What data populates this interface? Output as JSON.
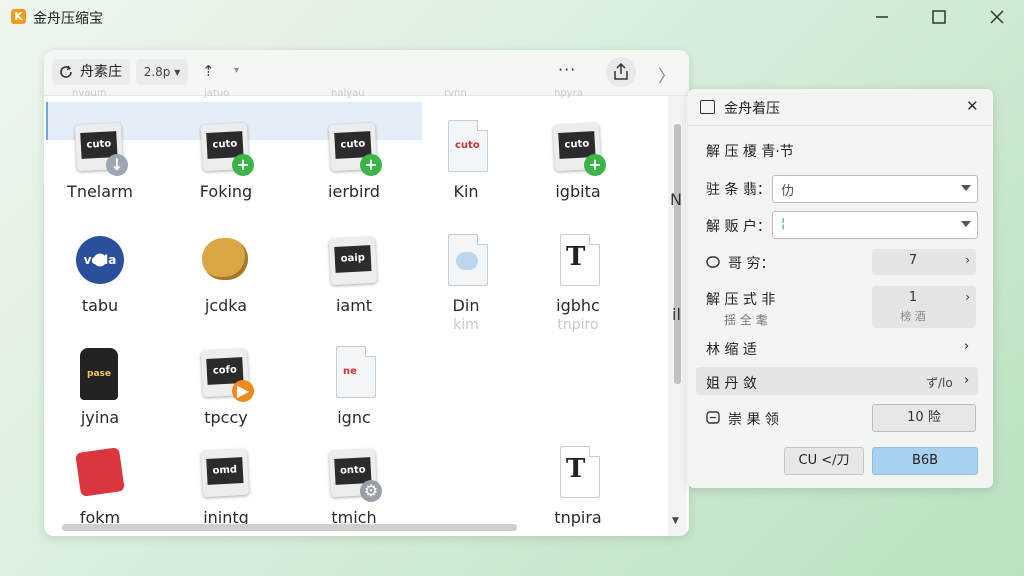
{
  "app": {
    "title": "金舟压缩宝",
    "logo_letter": "K"
  },
  "window_controls": {
    "minimize": "—",
    "maximize": "☐",
    "close": "✕"
  },
  "toolbar": {
    "path_label": "舟素庄",
    "size_label": "2.8p",
    "size_caret": "▾",
    "sort_symbol": "⇡",
    "sort_caret": "▾",
    "more": "···",
    "close_symbol": "〉"
  },
  "ghost_labels": [
    "nvaum",
    "jatuo",
    "nalyau",
    "rvnn",
    "npyra"
  ],
  "files": [
    {
      "name": "Tnelarm",
      "sub": "",
      "icon": "archive-icon",
      "tile_text": "cuto",
      "badge": "arrow",
      "badge_symbol": "↓"
    },
    {
      "name": "Foking",
      "sub": "",
      "icon": "archive-icon",
      "tile_text": "cuto",
      "badge": "plus",
      "badge_symbol": "+"
    },
    {
      "name": "ierbird",
      "sub": "",
      "icon": "archive-icon",
      "tile_text": "cuto",
      "badge": "plus",
      "badge_symbol": "+"
    },
    {
      "name": "Kin",
      "sub": "",
      "icon": "document-icon",
      "tile_text": "cuto",
      "badge": "none",
      "badge_symbol": ""
    },
    {
      "name": "igbita",
      "sub": "",
      "icon": "archive-icon",
      "tile_text": "cuto",
      "badge": "plus",
      "badge_symbol": "+"
    },
    {
      "name": "tabu",
      "sub": "",
      "icon": "disc-icon",
      "tile_text": "voda",
      "badge": "none",
      "badge_symbol": ""
    },
    {
      "name": "jcdka",
      "sub": "",
      "icon": "cookie-icon",
      "tile_text": "",
      "badge": "none",
      "badge_symbol": ""
    },
    {
      "name": "iamt",
      "sub": "",
      "icon": "archive-icon",
      "tile_text": "oaip",
      "badge": "none",
      "badge_symbol": ""
    },
    {
      "name": "Din",
      "sub": "kim",
      "icon": "document-icon",
      "tile_text": "",
      "badge": "none",
      "badge_symbol": ""
    },
    {
      "name": "igbhc",
      "sub": "tnpiro",
      "icon": "font-file-icon",
      "tile_text": "T",
      "badge": "none",
      "badge_symbol": ""
    },
    {
      "name": "jyina",
      "sub": "",
      "icon": "bottle-icon",
      "tile_text": "pase",
      "badge": "none",
      "badge_symbol": ""
    },
    {
      "name": "tpccy",
      "sub": "",
      "icon": "archive-icon",
      "tile_text": "cofo",
      "badge": "play",
      "badge_symbol": "▶"
    },
    {
      "name": "ignc",
      "sub": "",
      "icon": "document-icon",
      "tile_text": "ne",
      "badge": "none",
      "badge_symbol": ""
    },
    {
      "name": "",
      "sub": "",
      "icon": "",
      "tile_text": "",
      "badge": "none",
      "badge_symbol": ""
    },
    {
      "name": "",
      "sub": "",
      "icon": "",
      "tile_text": "",
      "badge": "none",
      "badge_symbol": ""
    },
    {
      "name": "fokm",
      "sub": "",
      "icon": "red-sticker-icon",
      "tile_text": "",
      "badge": "none",
      "badge_symbol": ""
    },
    {
      "name": "inintg",
      "sub": "",
      "icon": "archive-icon",
      "tile_text": "omd",
      "badge": "none",
      "badge_symbol": ""
    },
    {
      "name": "tmich",
      "sub": "",
      "icon": "archive-icon",
      "tile_text": "onto",
      "badge": "gear",
      "badge_symbol": "⚙"
    },
    {
      "name": "",
      "sub": "",
      "icon": "",
      "tile_text": "",
      "badge": "none",
      "badge_symbol": ""
    },
    {
      "name": "tnpira",
      "sub": "",
      "icon": "font-file-icon",
      "tile_text": "T",
      "badge": "none",
      "badge_symbol": ""
    }
  ],
  "side_letters": [
    "N",
    "il"
  ],
  "panel": {
    "title": "金舟着压",
    "close": "✕",
    "section": "解 压 榎 青·节",
    "row1": {
      "label": "驻 条 翡：",
      "value": "仂"
    },
    "row2": {
      "label": "解 贩 户：",
      "value": "¦"
    },
    "row3": {
      "label": "哥 穷：",
      "value": "7",
      "chev": "›"
    },
    "row4": {
      "label": "解 压 式 非",
      "sub": "揺 全 耄",
      "value": "1",
      "value_sub": "榜 酒",
      "chev": "›"
    },
    "row5": {
      "label": "林 缩 适",
      "chev": "›"
    },
    "row6": {
      "label": "姐 丹 敛",
      "value": "ず/lo",
      "chev": "›"
    },
    "row7": {
      "label": "崇 果 领",
      "value": "10 险"
    },
    "btn_cancel": "CU <∕刀",
    "btn_ok": "B6B"
  },
  "colors": {
    "accent": "#a8d0f0",
    "logo": "#f39a1c",
    "plus_badge": "#3bb54a",
    "play_badge": "#ef8b1a"
  }
}
